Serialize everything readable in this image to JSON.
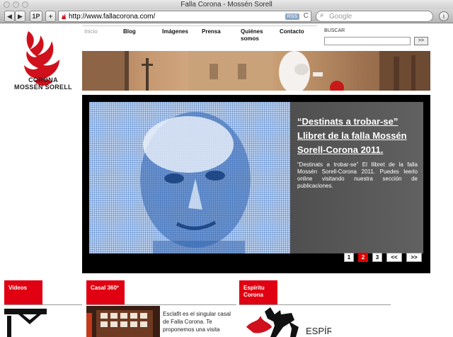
{
  "window": {
    "title": "Falla Corona - Mossén Sorell"
  },
  "toolbar": {
    "back": "◀",
    "forward": "▶",
    "one_p": "1P",
    "add": "+",
    "url": "http://www.fallacorona.com/",
    "rss": "RSS",
    "reload": "C",
    "search_placeholder": "Google",
    "info": "i"
  },
  "logo": {
    "line1": "CORONA",
    "line2": "MOSSÉN SORELL"
  },
  "nav": {
    "items": [
      "Inicio",
      "Blog",
      "Imágenes",
      "Prensa",
      "Quiénes somos",
      "Contacto"
    ]
  },
  "search": {
    "label": "BUSCAR",
    "button": ">>"
  },
  "slider": {
    "title": "“Destinats a trobar-se” Llibret de la falla Mossén Sorell-Corona 2011.",
    "description": "“Destinats a trobar-se” El llibret de la falla Mossén Sorell-Corona 2011. Puedes leerlo online visitando nuestra sección de publicaciones.",
    "pager": [
      "1",
      "2",
      "3",
      "<<",
      ">>"
    ],
    "active_page": "2"
  },
  "sections": [
    {
      "label": "Videos"
    },
    {
      "label": "Casal 360º"
    },
    {
      "label": "Espíritu Corona"
    }
  ],
  "casal": {
    "text": "Esclafit es el singular casal de Falla Corona. Te proponemos una visita"
  },
  "espiritu": {
    "logo_text": "ESPÍRITU"
  },
  "colors": {
    "accent": "#e00012",
    "brand_red": "#d0101c",
    "slide_blue": "#5c8ccf"
  }
}
